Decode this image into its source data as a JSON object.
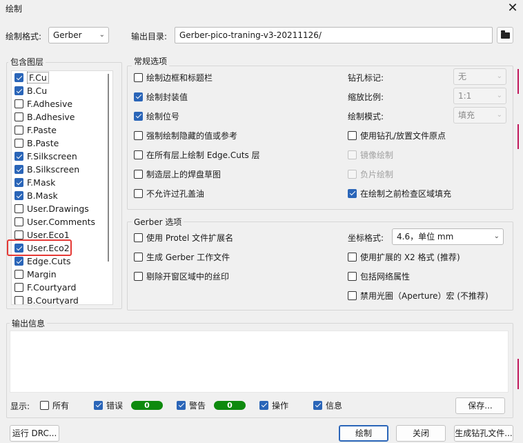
{
  "window": {
    "title": "绘制",
    "close_glyph": "✕"
  },
  "top": {
    "format_label": "绘制格式:",
    "format_value": "Gerber",
    "outdir_label": "输出目录:",
    "outdir_value": "Gerber-pico-traning-v3-20211126/"
  },
  "layers": {
    "title": "包含图层",
    "items": [
      {
        "label": "F.Cu",
        "checked": true
      },
      {
        "label": "B.Cu",
        "checked": true
      },
      {
        "label": "F.Adhesive",
        "checked": false
      },
      {
        "label": "B.Adhesive",
        "checked": false
      },
      {
        "label": "F.Paste",
        "checked": false
      },
      {
        "label": "B.Paste",
        "checked": false
      },
      {
        "label": "F.Silkscreen",
        "checked": true
      },
      {
        "label": "B.Silkscreen",
        "checked": true
      },
      {
        "label": "F.Mask",
        "checked": true
      },
      {
        "label": "B.Mask",
        "checked": true
      },
      {
        "label": "User.Drawings",
        "checked": false
      },
      {
        "label": "User.Comments",
        "checked": false
      },
      {
        "label": "User.Eco1",
        "checked": false
      },
      {
        "label": "User.Eco2",
        "checked": true
      },
      {
        "label": "Edge.Cuts",
        "checked": true
      },
      {
        "label": "Margin",
        "checked": false
      },
      {
        "label": "F.Courtyard",
        "checked": false
      },
      {
        "label": "B.Courtyard",
        "checked": false
      }
    ]
  },
  "general": {
    "title": "常规选项",
    "left": [
      {
        "label": "绘制边框和标题栏",
        "checked": false
      },
      {
        "label": "绘制封装值",
        "checked": true
      },
      {
        "label": "绘制位号",
        "checked": true
      },
      {
        "label": "强制绘制隐藏的值或参考",
        "checked": false
      },
      {
        "label": "在所有层上绘制 Edge.Cuts 层",
        "checked": false
      },
      {
        "label": "制造层上的焊盘草图",
        "checked": false
      },
      {
        "label": "不允许过孔盖油",
        "checked": false
      }
    ],
    "drill_marks_label": "钻孔标记:",
    "drill_marks_value": "无",
    "scale_label": "缩放比例:",
    "scale_value": "1:1",
    "plot_mode_label": "绘制模式:",
    "plot_mode_value": "填充",
    "right": [
      {
        "label": "使用钻孔/放置文件原点",
        "checked": false,
        "disabled": false
      },
      {
        "label": "镜像绘制",
        "checked": false,
        "disabled": true
      },
      {
        "label": "负片绘制",
        "checked": false,
        "disabled": true
      },
      {
        "label": "在绘制之前检查区域填充",
        "checked": true,
        "disabled": false
      }
    ]
  },
  "gerber": {
    "title": "Gerber 选项",
    "left": [
      {
        "label": "使用 Protel 文件扩展名",
        "checked": false
      },
      {
        "label": "生成 Gerber 工作文件",
        "checked": false
      },
      {
        "label": "剔除开窗区域中的丝印",
        "checked": false
      }
    ],
    "coord_label": "坐标格式:",
    "coord_value": "4.6，单位 mm",
    "right": [
      {
        "label": "使用扩展的 X2 格式 (推荐)",
        "checked": false
      },
      {
        "label": "包括网络属性",
        "checked": false
      },
      {
        "label": "禁用光圈（Aperture）宏 (不推荐)",
        "checked": false
      }
    ]
  },
  "output": {
    "title": "输出信息",
    "show_label": "显示:",
    "all_label": "所有",
    "errors_label": "错误",
    "errors_count": "0",
    "warnings_label": "警告",
    "warnings_count": "0",
    "actions_label": "操作",
    "info_label": "信息",
    "save_label": "保存..."
  },
  "buttons": {
    "drc": "运行 DRC...",
    "plot": "绘制",
    "close": "关闭",
    "drill": "生成钻孔文件..."
  },
  "colors": {
    "accent": "#2a65b8",
    "highlight": "#e53935",
    "badge": "#0e8a0e"
  }
}
